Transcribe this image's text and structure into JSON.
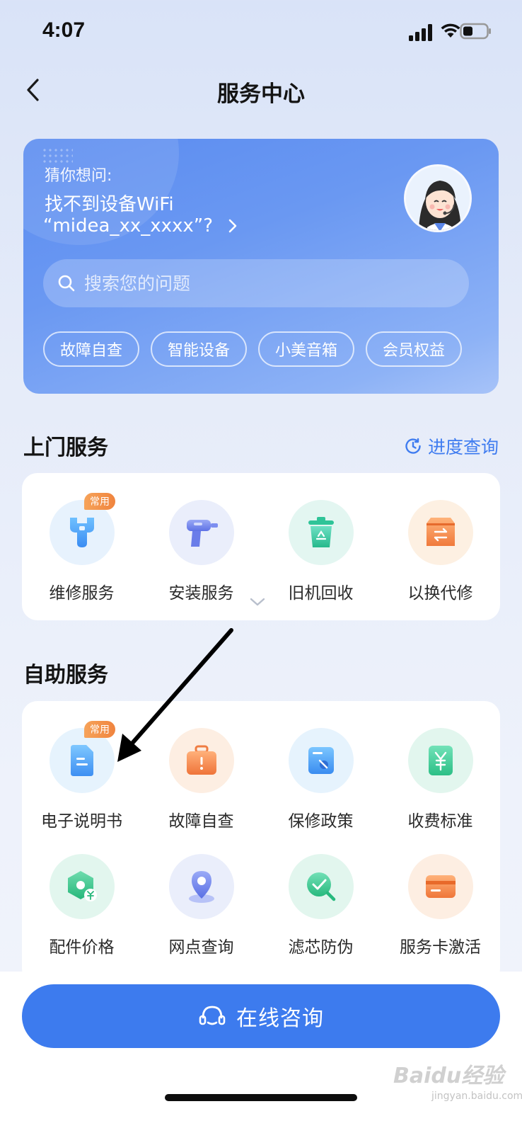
{
  "status": {
    "time": "4:07"
  },
  "header": {
    "title": "服务中心"
  },
  "hero": {
    "kicker": "猜你想问:",
    "question_line1": "找不到设备WiFi",
    "question_line2": "“midea_xx_xxxx”?",
    "search_placeholder": "搜索您的问题",
    "chips": [
      "故障自查",
      "智能设备",
      "小美音箱",
      "会员权益"
    ]
  },
  "onsite": {
    "title": "上门服务",
    "progress_link": "进度查询",
    "items": [
      {
        "label": "维修服务",
        "icon": "wrench-icon",
        "badge": "常用"
      },
      {
        "label": "安装服务",
        "icon": "drill-icon"
      },
      {
        "label": "旧机回收",
        "icon": "recycle-bin-icon"
      },
      {
        "label": "以换代修",
        "icon": "exchange-box-icon"
      }
    ]
  },
  "self": {
    "title": "自助服务",
    "row1": [
      {
        "label": "电子说明书",
        "icon": "manual-document-icon",
        "badge": "常用"
      },
      {
        "label": "故障自查",
        "icon": "toolbox-alert-icon"
      },
      {
        "label": "保修政策",
        "icon": "warranty-policy-icon"
      },
      {
        "label": "收费标准",
        "icon": "yuan-fee-icon"
      }
    ],
    "row2": [
      {
        "label": "配件价格",
        "icon": "parts-price-icon"
      },
      {
        "label": "网点查询",
        "icon": "location-pin-icon"
      },
      {
        "label": "滤芯防伪",
        "icon": "filter-verify-icon"
      },
      {
        "label": "服务卡激活",
        "icon": "service-card-icon"
      }
    ]
  },
  "cta": {
    "label": "在线咨询"
  },
  "watermark": {
    "brand": "Baidu经验",
    "url": "jingyan.baidu.com"
  },
  "colors": {
    "primary": "#3d7bee",
    "hero_start": "#5b8cf0",
    "badge": "#f0843e"
  }
}
